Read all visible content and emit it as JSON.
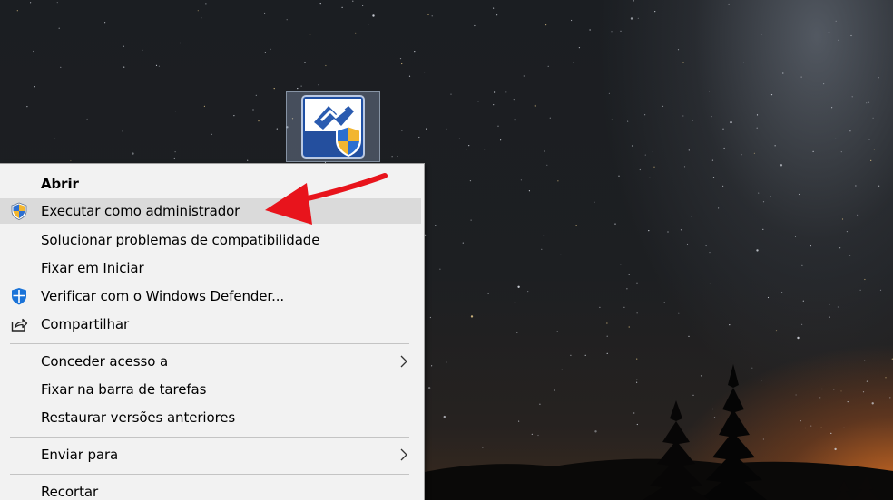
{
  "desktop": {
    "icon": {
      "name": "receita-federal-app-icon",
      "badge": "uac-shield-icon"
    }
  },
  "context_menu": {
    "items": [
      {
        "label": "Abrir",
        "bold": true,
        "icon": null
      },
      {
        "label": "Executar como administrador",
        "icon": "uac-shield-icon",
        "highlighted": true
      },
      {
        "label": "Solucionar problemas de compatibilidade",
        "icon": null
      },
      {
        "label": "Fixar em Iniciar",
        "icon": null
      },
      {
        "label": "Verificar com o Windows Defender...",
        "icon": "windows-defender-icon"
      },
      {
        "label": "Compartilhar",
        "icon": "share-icon"
      },
      {
        "label": "Conceder acesso a",
        "icon": null,
        "submenu": true
      },
      {
        "label": "Fixar na barra de tarefas",
        "icon": null
      },
      {
        "label": "Restaurar versões anteriores",
        "icon": null
      },
      {
        "label": "Enviar para",
        "icon": null,
        "submenu": true
      },
      {
        "label": "Recortar",
        "icon": null
      }
    ]
  },
  "annotation": {
    "type": "red-arrow",
    "color": "#e8141c"
  },
  "colors": {
    "menu_bg": "#f2f2f2",
    "menu_highlight": "#dadada",
    "separator": "#c4c4c4",
    "shield_blue": "#2c6fd1",
    "shield_yellow": "#f2b630",
    "defender_blue": "#1a73d8"
  }
}
